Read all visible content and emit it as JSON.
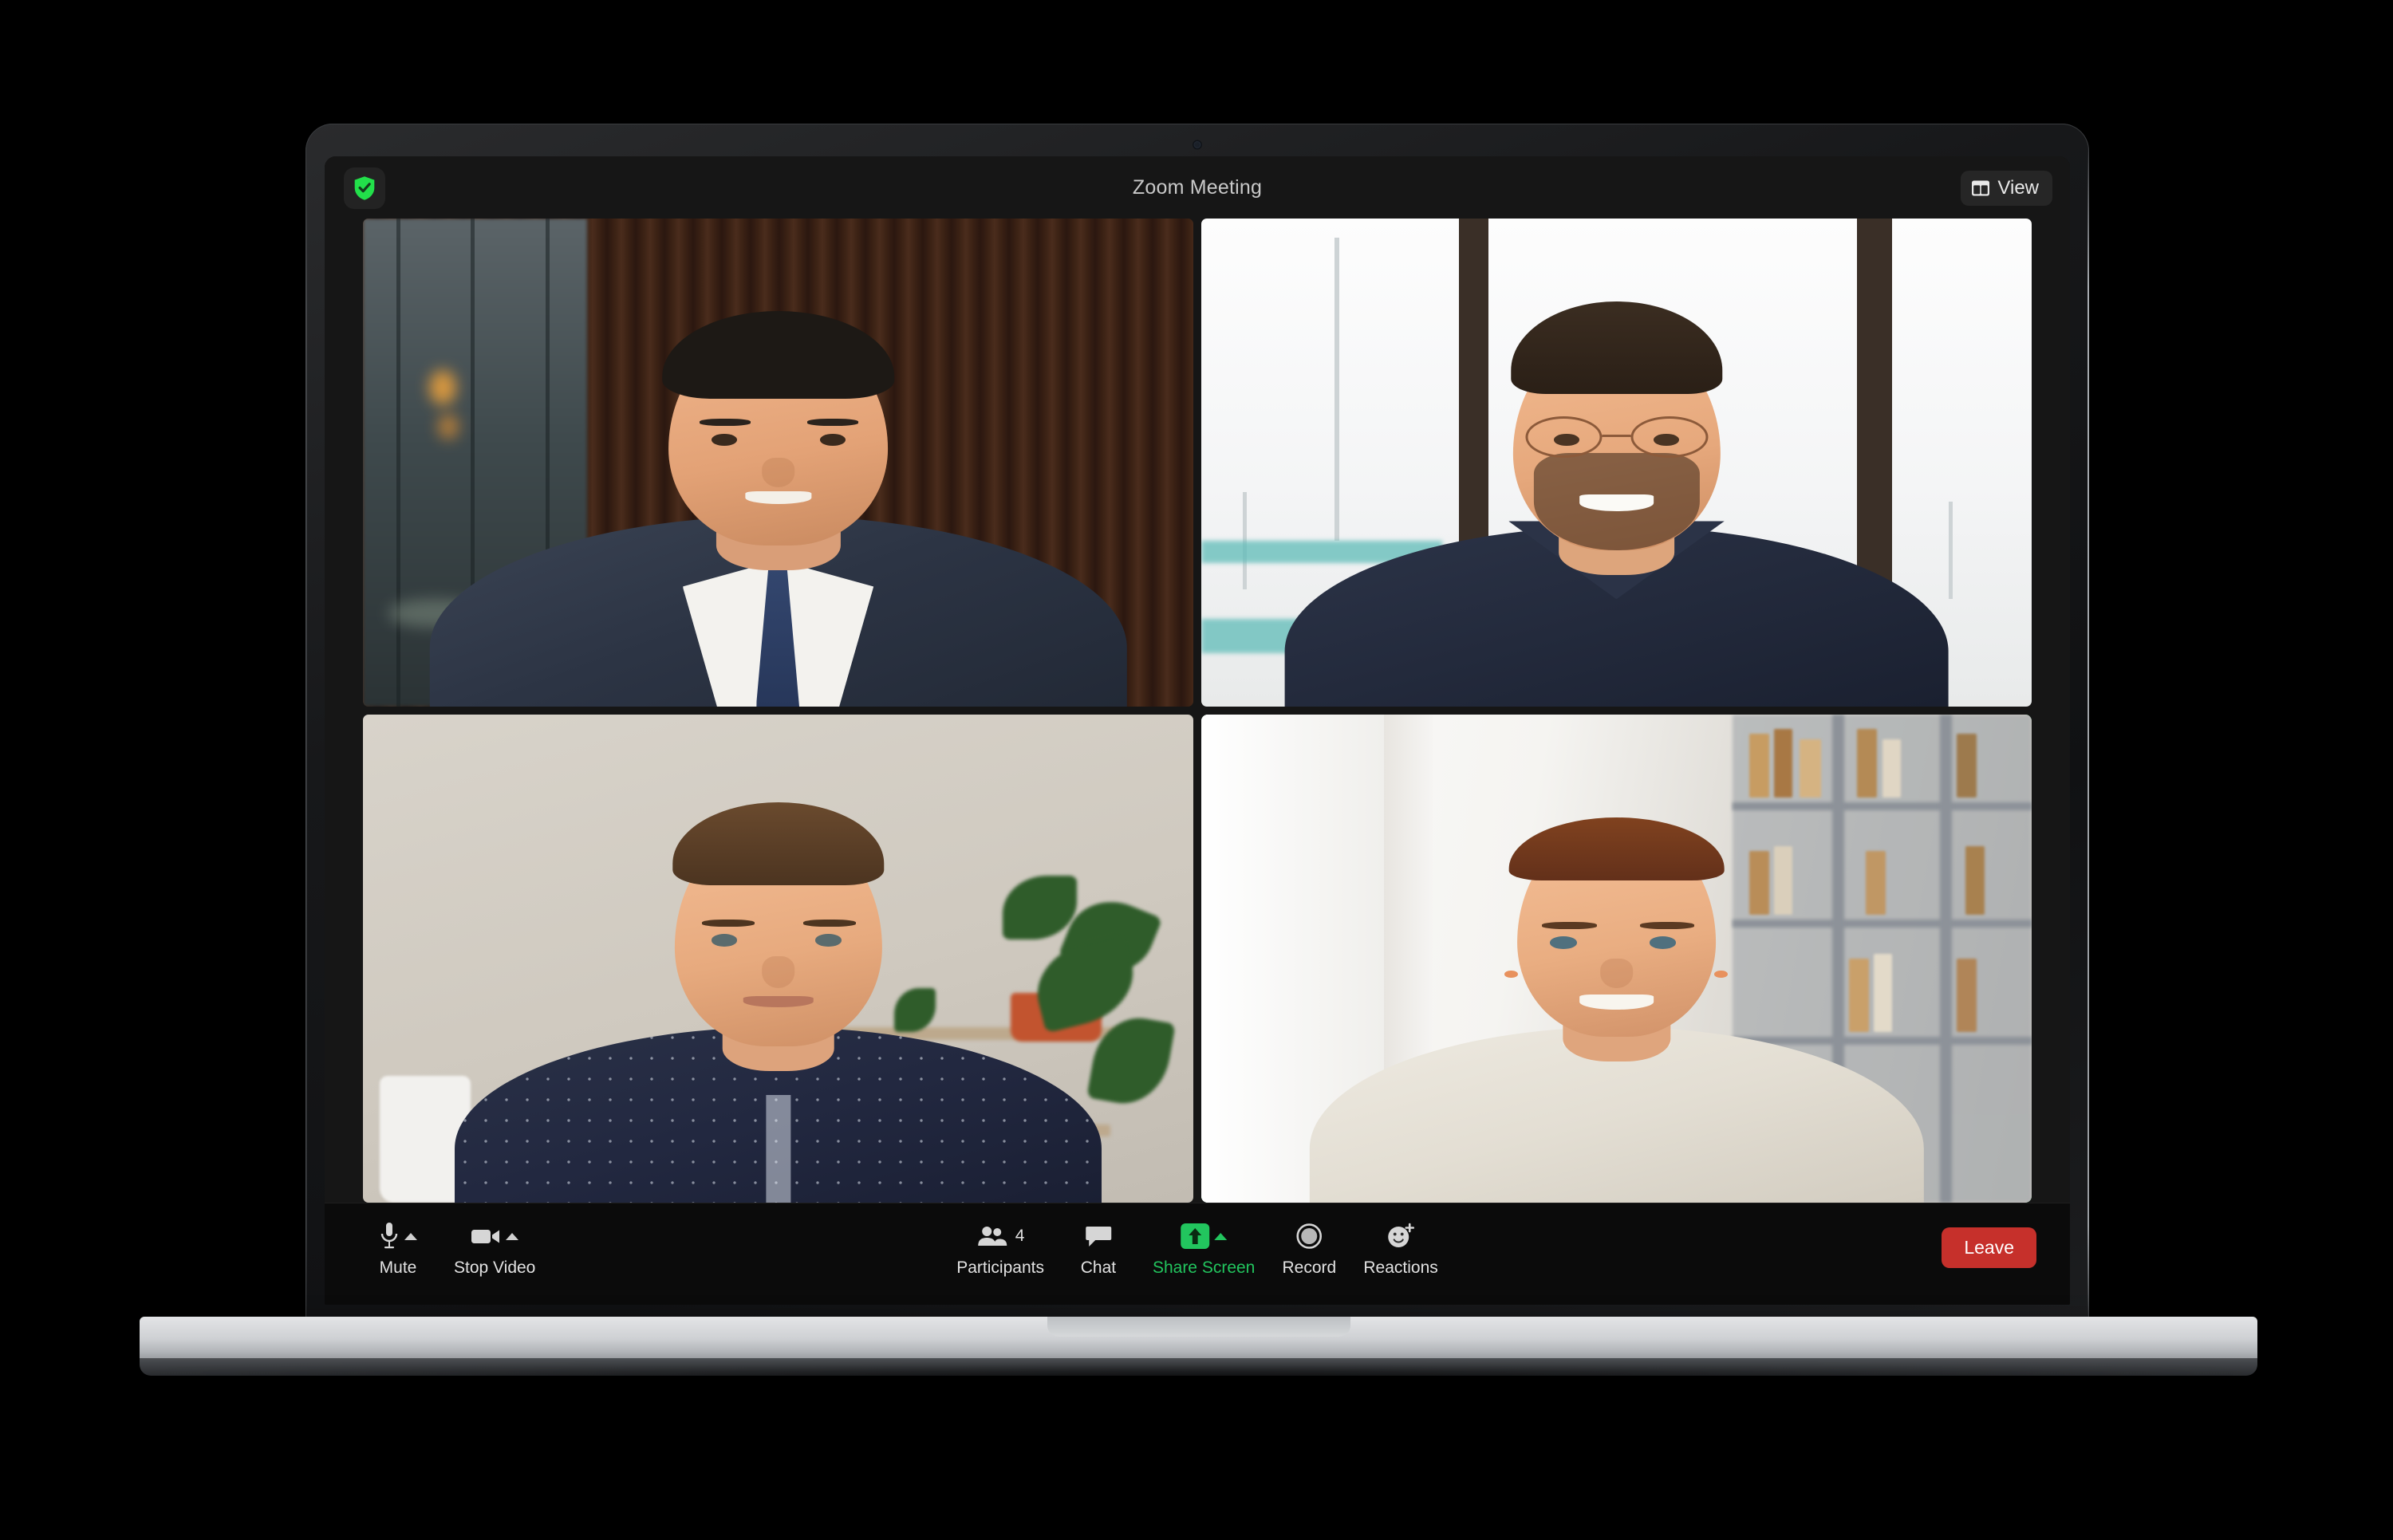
{
  "window": {
    "title": "Zoom Meeting",
    "encryption_icon": "shield-check-icon",
    "view_button_label": "View",
    "view_button_icon": "layout-grid-icon"
  },
  "theme": {
    "accent_green": "#22c55e",
    "leave_red": "#c6302b",
    "app_background": "#161616",
    "toolbar_background": "#0b0b0b",
    "title_text": "#c9c9c9"
  },
  "video_grid": {
    "participant_count": 4,
    "tiles": [
      {
        "position": "top-left",
        "active_speaker": false,
        "description": "Man in navy pinstripe suit with blue tie, dark wood slat office wall"
      },
      {
        "position": "top-right",
        "active_speaker": false,
        "description": "Bearded man with round glasses in navy shirt, bright window background"
      },
      {
        "position": "bottom-left",
        "active_speaker": false,
        "description": "Man with short brown hair in navy polka dot shirt, beige wall with plants"
      },
      {
        "position": "bottom-right",
        "active_speaker": true,
        "description": "Woman with auburn bob in cream sweater, bookshelf background"
      }
    ]
  },
  "toolbar": {
    "left_controls": [
      {
        "label": "Mute",
        "icon": "microphone-icon",
        "has_chevron": true,
        "active": false
      },
      {
        "label": "Stop Video",
        "icon": "video-camera-icon",
        "has_chevron": true,
        "active": false
      }
    ],
    "center_controls": [
      {
        "label": "Participants",
        "icon": "people-icon",
        "badge": "4",
        "has_chevron": false,
        "active": false
      },
      {
        "label": "Chat",
        "icon": "speech-bubble-icon",
        "has_chevron": false,
        "active": false
      },
      {
        "label": "Share Screen",
        "icon": "share-up-arrow-icon",
        "has_chevron": true,
        "active": true
      },
      {
        "label": "Record",
        "icon": "record-circle-icon",
        "has_chevron": false,
        "active": false
      },
      {
        "label": "Reactions",
        "icon": "smiley-plus-icon",
        "has_chevron": false,
        "active": false
      }
    ],
    "leave_label": "Leave"
  }
}
